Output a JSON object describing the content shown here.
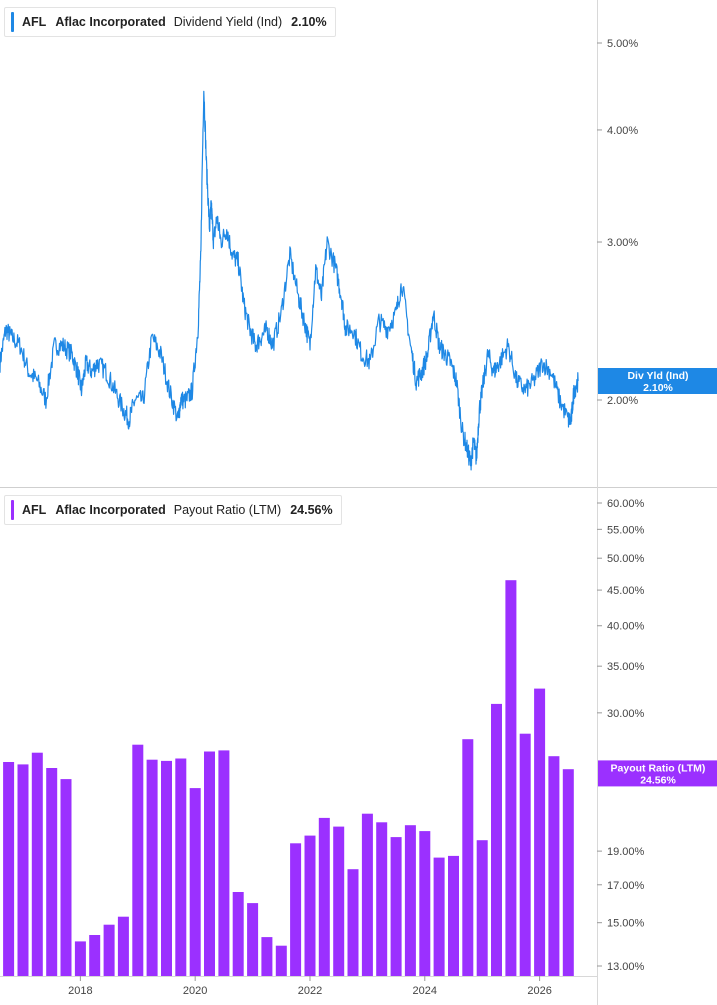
{
  "legends": [
    {
      "ticker": "AFL",
      "name": "Aflac Incorporated",
      "metric": "Dividend Yield (Ind)",
      "value": "2.10%"
    },
    {
      "ticker": "AFL",
      "name": "Aflac Incorporated",
      "metric": "Payout Ratio (LTM)",
      "value": "24.56%"
    }
  ],
  "colors": {
    "dividend_yield": "#1e88e5",
    "payout_ratio": "#9b30ff",
    "grid_line": "#e4e4e4",
    "axis_text": "#444444"
  },
  "chart_data": [
    {
      "type": "line",
      "series": [
        {
          "name": "Dividend Yield (Ind)",
          "color": "#1e88e5",
          "x": [
            2016.6,
            2016.7,
            2016.8,
            2016.95,
            2017.1,
            2017.25,
            2017.4,
            2017.55,
            2017.7,
            2017.85,
            2017.95,
            2018.02,
            2018.1,
            2018.2,
            2018.3,
            2018.45,
            2018.6,
            2018.75,
            2018.85,
            2018.95,
            2019.1,
            2019.25,
            2019.4,
            2019.55,
            2019.7,
            2019.75,
            2019.85,
            2019.95,
            2020.05,
            2020.1,
            2020.15,
            2020.2,
            2020.25,
            2020.28,
            2020.32,
            2020.38,
            2020.45,
            2020.55,
            2020.65,
            2020.75,
            2020.85,
            2020.95,
            2021.05,
            2021.15,
            2021.25,
            2021.35,
            2021.5,
            2021.65,
            2021.8,
            2021.9,
            2022.0,
            2022.1,
            2022.2,
            2022.3,
            2022.45,
            2022.55,
            2022.62,
            2022.75,
            2022.9,
            2023.05,
            2023.2,
            2023.35,
            2023.5,
            2023.6,
            2023.75,
            2023.85,
            2023.95,
            2024.05,
            2024.15,
            2024.25,
            2024.35,
            2024.45,
            2024.55,
            2024.65,
            2024.75,
            2024.8,
            2024.85,
            2024.9,
            2024.95,
            2025.0,
            2025.1,
            2025.2,
            2025.3,
            2025.45,
            2025.6,
            2025.75,
            2025.9,
            2026.05,
            2026.2,
            2026.35,
            2026.5,
            2026.55,
            2026.6,
            2026.67
          ],
          "y": [
            2.2,
            2.4,
            2.35,
            2.3,
            2.15,
            2.1,
            2.0,
            2.3,
            2.3,
            2.25,
            2.15,
            2.05,
            2.2,
            2.15,
            2.2,
            2.15,
            2.05,
            1.95,
            1.9,
            2.0,
            2.0,
            2.35,
            2.25,
            2.05,
            1.9,
            2.0,
            2.0,
            2.05,
            2.4,
            2.9,
            4.45,
            3.6,
            3.1,
            3.3,
            3.0,
            3.2,
            3.0,
            3.1,
            2.9,
            2.85,
            2.55,
            2.4,
            2.3,
            2.35,
            2.4,
            2.3,
            2.5,
            2.9,
            2.6,
            2.45,
            2.3,
            2.8,
            2.6,
            3.0,
            2.8,
            2.6,
            2.4,
            2.4,
            2.25,
            2.2,
            2.45,
            2.4,
            2.5,
            2.7,
            2.3,
            2.1,
            2.15,
            2.25,
            2.5,
            2.3,
            2.25,
            2.2,
            2.1,
            1.85,
            1.75,
            1.7,
            1.8,
            1.72,
            1.95,
            2.05,
            2.25,
            2.15,
            2.2,
            2.3,
            2.1,
            2.05,
            2.1,
            2.2,
            2.15,
            2.0,
            1.9,
            1.9,
            2.05,
            2.1
          ]
        }
      ],
      "y_axis": {
        "scale": "log",
        "ticks": [
          2,
          3,
          4,
          5
        ],
        "tick_labels": [
          "2.00%",
          "3.00%",
          "4.00%",
          "5.00%"
        ],
        "position": "right"
      },
      "current_value_flag": {
        "line1": "Div Yld (Ind)",
        "line2": "2.10%",
        "value": 2.1
      },
      "grid": false
    },
    {
      "type": "bar",
      "series": [
        {
          "name": "Payout Ratio (LTM)",
          "color": "#9b30ff",
          "x": [
            2016.75,
            2017.0,
            2017.25,
            2017.5,
            2017.75,
            2018.0,
            2018.25,
            2018.5,
            2018.75,
            2019.0,
            2019.25,
            2019.5,
            2019.75,
            2020.0,
            2020.25,
            2020.5,
            2020.75,
            2021.0,
            2021.25,
            2021.5,
            2021.75,
            2022.0,
            2022.25,
            2022.5,
            2022.75,
            2023.0,
            2023.25,
            2023.5,
            2023.75,
            2024.0,
            2024.25,
            2024.5,
            2024.75,
            2025.0,
            2025.25,
            2025.5,
            2025.75,
            2026.0,
            2026.25,
            2026.5
          ],
          "values": [
            25.5,
            25.3,
            26.3,
            25.0,
            24.1,
            14.1,
            14.4,
            14.9,
            15.3,
            27.0,
            25.7,
            25.6,
            25.8,
            23.4,
            26.4,
            26.5,
            16.6,
            16.0,
            14.3,
            13.9,
            19.5,
            20.0,
            21.2,
            20.6,
            17.9,
            21.5,
            20.9,
            19.9,
            20.7,
            20.3,
            18.6,
            18.7,
            27.5,
            19.7,
            30.9,
            46.5,
            28.0,
            32.5,
            26.0,
            24.9
          ]
        }
      ],
      "y_axis": {
        "scale": "log",
        "ticks": [
          13,
          15,
          17,
          19,
          30,
          35,
          40,
          45,
          50,
          55,
          60
        ],
        "tick_labels": [
          "13.00%",
          "15.00%",
          "17.00%",
          "19.00%",
          "30.00%",
          "35.00%",
          "40.00%",
          "45.00%",
          "50.00%",
          "55.00%",
          "60.00%"
        ],
        "position": "right"
      },
      "current_value_flag": {
        "line1": "Payout Ratio (LTM)",
        "line2": "24.56%",
        "value": 24.56
      },
      "grid": false
    }
  ],
  "x_axis": {
    "ticks": [
      2018,
      2020,
      2022,
      2024,
      2026
    ],
    "tick_labels": [
      "2018",
      "2020",
      "2022",
      "2024",
      "2026"
    ]
  }
}
